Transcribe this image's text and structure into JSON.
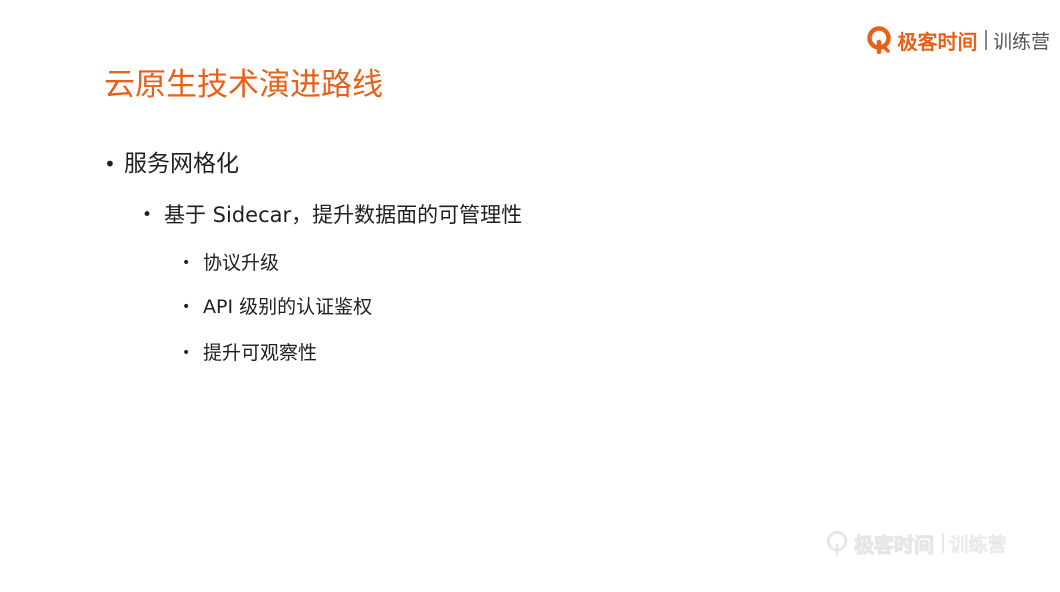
{
  "brand": {
    "name": "极客时间",
    "sub": "训练营",
    "accent_color": "#e8611a",
    "icon": "geektime-logo-icon"
  },
  "slide": {
    "title": "云原生技术演进路线",
    "title_color": "#e8611a",
    "bullets": {
      "level1": "服务网格化",
      "level2": "基于 Sidecar，提升数据面的可管理性",
      "level3": [
        "协议升级",
        "API 级别的认证鉴权",
        "提升可观察性"
      ]
    }
  },
  "watermark": {
    "name": "极客时间",
    "sub": "训练营"
  }
}
